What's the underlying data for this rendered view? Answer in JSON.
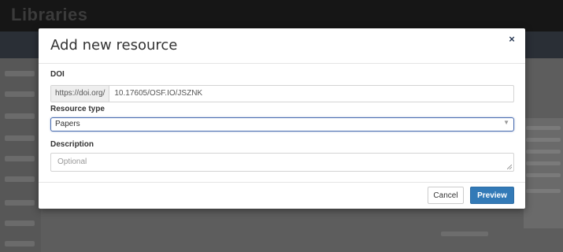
{
  "background": {
    "title": "Libraries"
  },
  "modal": {
    "title": "Add new resource",
    "close_icon": "close-icon",
    "close_glyph": "×",
    "doi": {
      "label": "DOI",
      "prefix": "https://doi.org/",
      "value": "10.17605/OSF.IO/JSZNK"
    },
    "resource_type": {
      "label": "Resource type",
      "selected": "Papers",
      "arrow_glyph": "▼"
    },
    "description": {
      "label": "Description",
      "placeholder": "Optional",
      "value": ""
    },
    "footer": {
      "cancel_label": "Cancel",
      "preview_label": "Preview"
    }
  },
  "colors": {
    "primary": "#337ab7",
    "focus_border": "#4a6db0",
    "backdrop": "#5d5d5d",
    "title_text": "#333333",
    "close_icon": "#2a3a55"
  }
}
